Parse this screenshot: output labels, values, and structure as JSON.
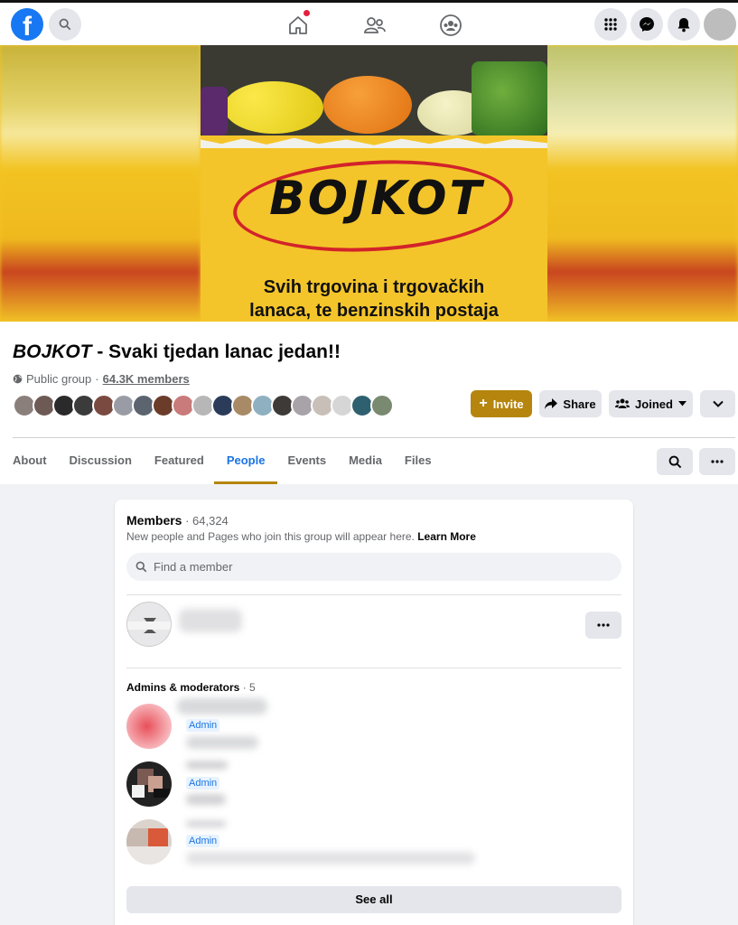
{
  "group": {
    "title_brand": "BOJKOT",
    "title_rest": " - Svaki tjedan lanac jedan!!",
    "privacy": "Public group",
    "meta_sep": "·",
    "members_link": "64.3K members"
  },
  "cover": {
    "headline": "BOJKOT",
    "subtitle_line1": "Svih trgovina i trgovačkih",
    "subtitle_line2": "lanaca, te benzinskih postaja"
  },
  "actions": {
    "invite": "Invite",
    "share": "Share",
    "joined": "Joined"
  },
  "tabs": [
    {
      "label": "About"
    },
    {
      "label": "Discussion"
    },
    {
      "label": "Featured"
    },
    {
      "label": "People",
      "active": true
    },
    {
      "label": "Events"
    },
    {
      "label": "Media"
    },
    {
      "label": "Files"
    }
  ],
  "members": {
    "title": "Members",
    "count": " · 64,324",
    "description": "New people and Pages who join this group will appear here.",
    "learn_more": "Learn More",
    "search_placeholder": "Find a member",
    "admins_title": "Admins & moderators",
    "admins_count": " · 5",
    "admin_label": "Admin",
    "see_all": "See all"
  },
  "colors": {
    "facebook_blue": "#1877f2",
    "accent_gold": "#b5850e",
    "link_blue": "#1b74e4",
    "cover_yellow": "#f4c52a",
    "cover_red": "#d2232a"
  },
  "icons": [
    "facebook-logo-icon",
    "search-icon",
    "home-icon",
    "friends-icon",
    "groups-icon",
    "apps-grid-icon",
    "messenger-icon",
    "notifications-icon",
    "globe-icon",
    "plus-icon",
    "share-arrow-icon",
    "joined-people-icon",
    "chevron-down-icon",
    "more-dots-icon"
  ]
}
